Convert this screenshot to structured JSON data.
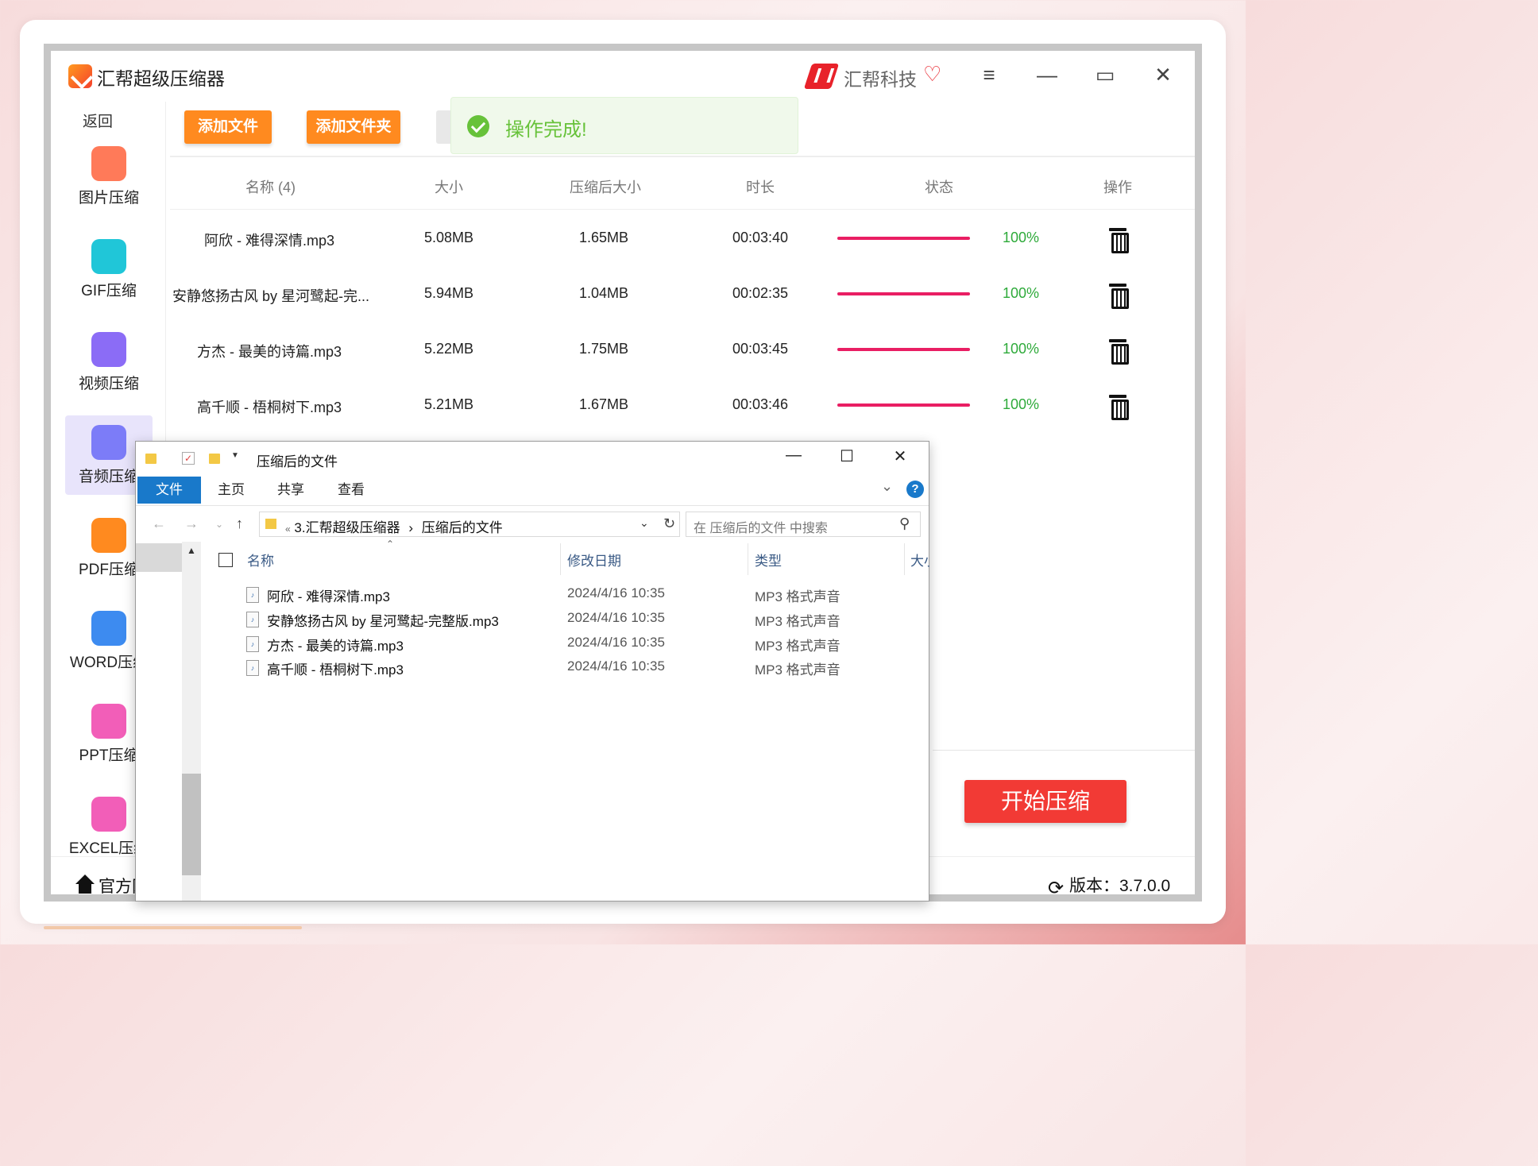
{
  "app": {
    "title": "汇帮超级压缩器",
    "brand": "汇帮科技",
    "brand_heart": "♡",
    "controls": {
      "menu": "≡",
      "minimize": "—",
      "maximize": "▭",
      "close": "✕"
    }
  },
  "sidebar": {
    "back_label": "返回",
    "items": [
      {
        "label": "图片压缩",
        "icon": "image-icon",
        "color": "#ff7a59"
      },
      {
        "label": "GIF压缩",
        "icon": "gif-icon",
        "color": "#20c6d8"
      },
      {
        "label": "视频压缩",
        "icon": "video-play-icon",
        "color": "#8b6cf6"
      },
      {
        "label": "音频压缩",
        "icon": "audio-icon",
        "color": "#7c7cf8"
      },
      {
        "label": "PDF压缩",
        "icon": "pdf-file-icon",
        "color": "#ff8a1f"
      },
      {
        "label": "WORD压缩",
        "icon": "word-file-icon",
        "color": "#3d8bf0"
      },
      {
        "label": "PPT压缩",
        "icon": "ppt-file-icon",
        "color": "#f25eb8"
      },
      {
        "label": "EXCEL压缩",
        "icon": "excel-file-icon",
        "color": "#f25eb8"
      }
    ],
    "active_index": 3
  },
  "toolbar": {
    "add_file": "添加文件",
    "add_folder": "添加文件夹"
  },
  "toast": {
    "message": "操作完成!"
  },
  "table": {
    "headers": {
      "name": "名称 (4)",
      "size": "大小",
      "compressed_size": "压缩后大小",
      "duration": "时长",
      "status": "状态",
      "action": "操作"
    },
    "rows": [
      {
        "name": "阿欣 - 难得深情.mp3",
        "size": "5.08MB",
        "compressed": "1.65MB",
        "duration": "00:03:40",
        "progress": 100,
        "percent": "100%"
      },
      {
        "name": "安静悠扬古风 by 星河鹭起-完...",
        "size": "5.94MB",
        "compressed": "1.04MB",
        "duration": "00:02:35",
        "progress": 100,
        "percent": "100%"
      },
      {
        "name": "方杰 - 最美的诗篇.mp3",
        "size": "5.22MB",
        "compressed": "1.75MB",
        "duration": "00:03:45",
        "progress": 100,
        "percent": "100%"
      },
      {
        "name": "高千顺 - 梧桐树下.mp3",
        "size": "5.21MB",
        "compressed": "1.67MB",
        "duration": "00:03:46",
        "progress": 100,
        "percent": "100%"
      }
    ]
  },
  "start_button": "开始压缩",
  "footer": {
    "website_label": "官方网",
    "version_label": "版本：3.7.0.0"
  },
  "explorer": {
    "title": "压缩后的文件",
    "controls": {
      "minimize": "—",
      "maximize": "☐",
      "close": "✕"
    },
    "ribbon_tabs": [
      "文件",
      "主页",
      "共享",
      "查看"
    ],
    "help": "?",
    "address": {
      "prefix": "«",
      "path": [
        "3.汇帮超级压缩器",
        "压缩后的文件"
      ],
      "separator": "›"
    },
    "search_placeholder": "在 压缩后的文件 中搜索",
    "columns": {
      "name": "名称",
      "date": "修改日期",
      "type": "类型",
      "size": "大小"
    },
    "files": [
      {
        "name": "阿欣 - 难得深情.mp3",
        "date": "2024/4/16 10:35",
        "type": "MP3 格式声音"
      },
      {
        "name": "安静悠扬古风 by 星河鹭起-完整版.mp3",
        "date": "2024/4/16 10:35",
        "type": "MP3 格式声音"
      },
      {
        "name": "方杰 - 最美的诗篇.mp3",
        "date": "2024/4/16 10:35",
        "type": "MP3 格式声音"
      },
      {
        "name": "高千顺 - 梧桐树下.mp3",
        "date": "2024/4/16 10:35",
        "type": "MP3 格式声音"
      }
    ]
  }
}
